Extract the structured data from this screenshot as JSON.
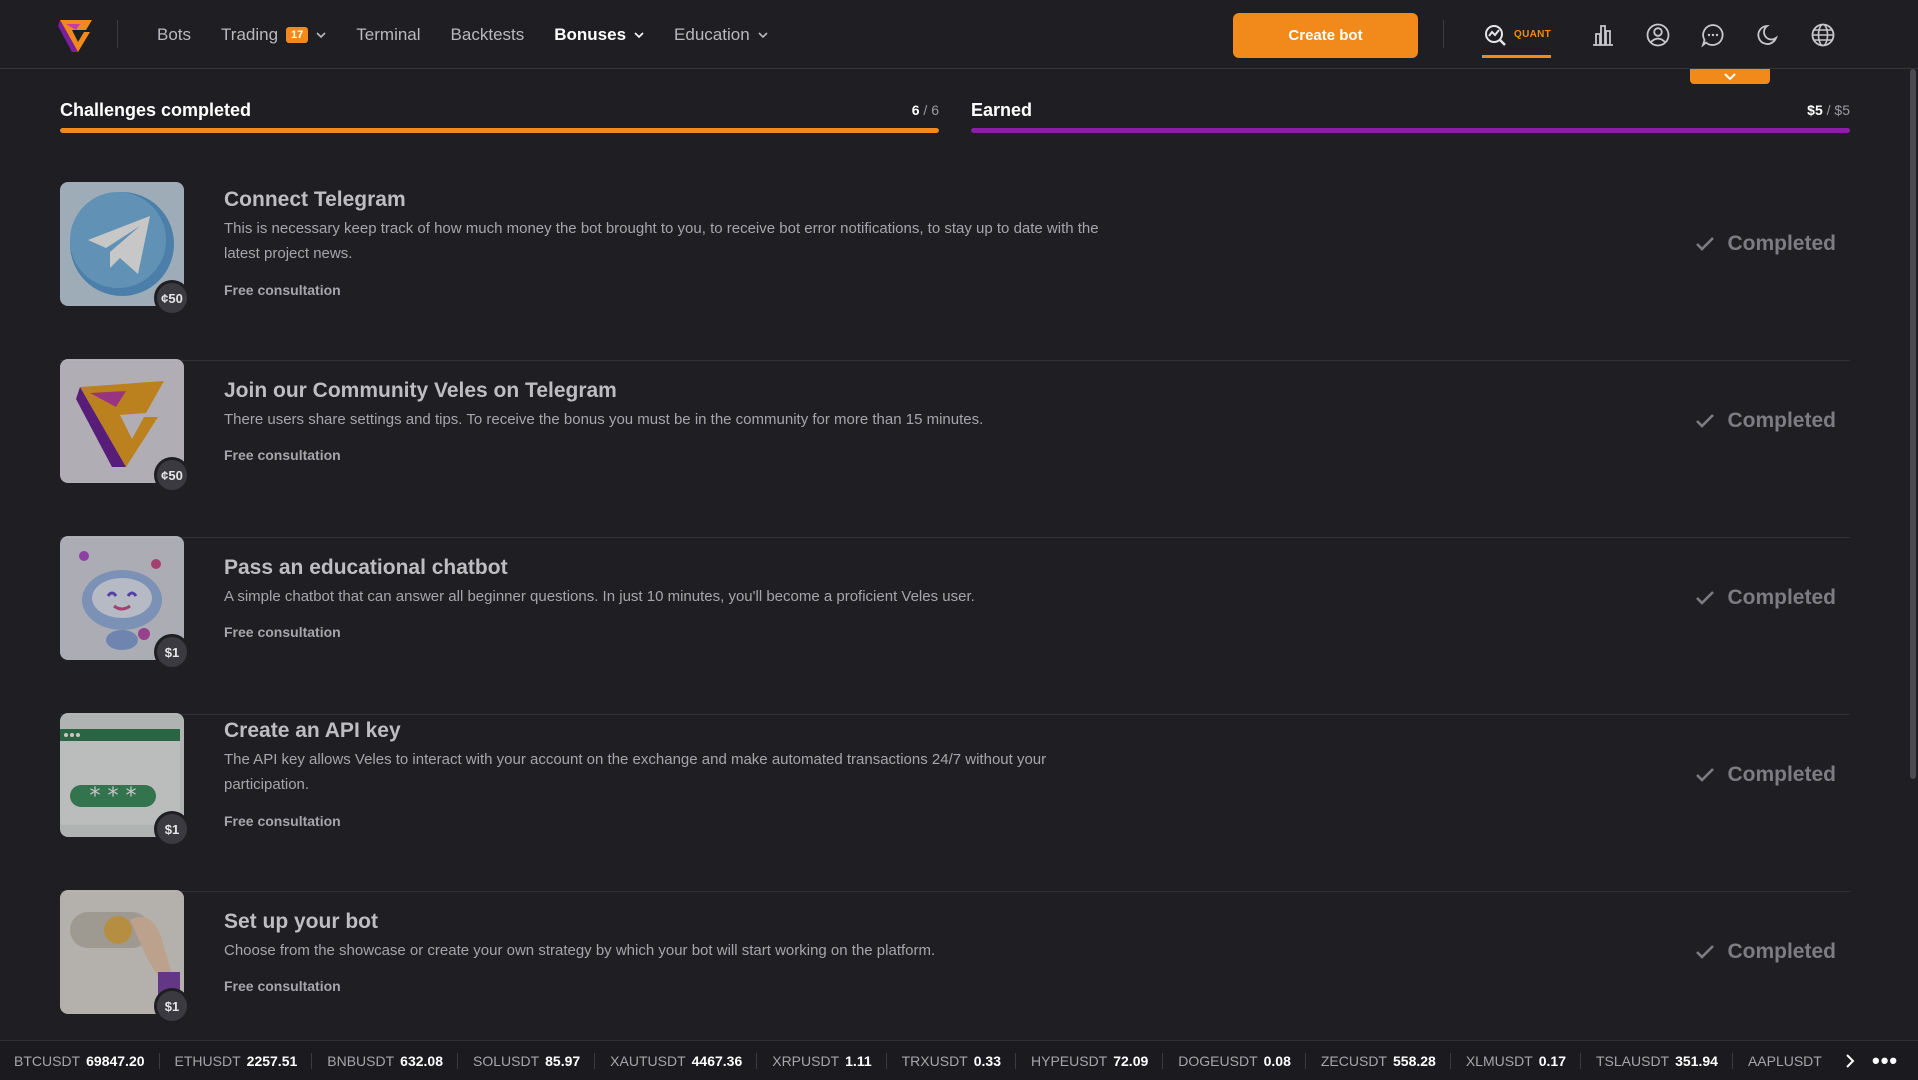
{
  "nav": {
    "items": [
      {
        "label": "Bots",
        "badge": "",
        "dropdown": false,
        "active": false
      },
      {
        "label": "Trading",
        "badge": "17",
        "dropdown": true,
        "active": false
      },
      {
        "label": "Terminal",
        "badge": "",
        "dropdown": false,
        "active": false
      },
      {
        "label": "Backtests",
        "badge": "",
        "dropdown": false,
        "active": false
      },
      {
        "label": "Bonuses",
        "badge": "",
        "dropdown": true,
        "active": true
      },
      {
        "label": "Education",
        "badge": "",
        "dropdown": true,
        "active": false
      }
    ],
    "create_bot_label": "Create bot",
    "quant_label": "QUANT",
    "icons": [
      "chart-bar-icon",
      "user-circle-icon",
      "chat-icon",
      "moon-icon",
      "globe-icon"
    ]
  },
  "progress": {
    "challenges": {
      "title": "Challenges completed",
      "done": "6",
      "total": "6",
      "fraction": 1.0,
      "color": "#f28a1b"
    },
    "earned": {
      "title": "Earned",
      "done": "$5",
      "total": "$5",
      "fraction": 1.0,
      "color": "#8a1ea8"
    }
  },
  "challenges": [
    {
      "title": "Connect Telegram",
      "desc": "This is necessary keep track of how much money the bot brought to you, to receive bot error notifications, to stay up to date with the latest project news.",
      "link": "Free consultation",
      "reward": "¢50",
      "status": "Completed",
      "thumb": "telegram"
    },
    {
      "title": "Join our Community Veles on Telegram",
      "desc": "There users share settings and tips. To receive the bonus you must be in the community for more than 15 minutes.",
      "link": "Free consultation",
      "reward": "¢50",
      "status": "Completed",
      "thumb": "veles"
    },
    {
      "title": "Pass an educational chatbot",
      "desc": "A simple chatbot that can answer all beginner questions. In just 10 minutes, you'll become a proficient Veles user.",
      "link": "Free consultation",
      "reward": "$1",
      "status": "Completed",
      "thumb": "robot"
    },
    {
      "title": "Create an API key",
      "desc": "The API key allows Veles to interact with your account on the exchange and make automated transactions 24/7 without your participation.",
      "link": "Free consultation",
      "reward": "$1",
      "status": "Completed",
      "thumb": "api"
    },
    {
      "title": "Set up your bot",
      "desc": "Choose from the showcase or create your own strategy by which your bot will start working on the platform.",
      "link": "Free consultation",
      "reward": "$1",
      "status": "Completed",
      "thumb": "toggle"
    }
  ],
  "ticker": [
    {
      "symbol": "BTCUSDT",
      "price": "69847.20"
    },
    {
      "symbol": "ETHUSDT",
      "price": "2257.51"
    },
    {
      "symbol": "BNBUSDT",
      "price": "632.08"
    },
    {
      "symbol": "SOLUSDT",
      "price": "85.97"
    },
    {
      "symbol": "XAUTUSDT",
      "price": "4467.36"
    },
    {
      "symbol": "XRPUSDT",
      "price": "1.11"
    },
    {
      "symbol": "TRXUSDT",
      "price": "0.33"
    },
    {
      "symbol": "HYPEUSDT",
      "price": "72.09"
    },
    {
      "symbol": "DOGEUSDT",
      "price": "0.08"
    },
    {
      "symbol": "ZECUSDT",
      "price": "558.28"
    },
    {
      "symbol": "XLMUSDT",
      "price": "0.17"
    },
    {
      "symbol": "TSLAUSDT",
      "price": "351.94"
    },
    {
      "symbol": "AAPLUSDT",
      "price": ""
    }
  ],
  "colors": {
    "accent": "#f28a1b",
    "earned": "#8a1ea8",
    "background": "#1f1f23"
  }
}
